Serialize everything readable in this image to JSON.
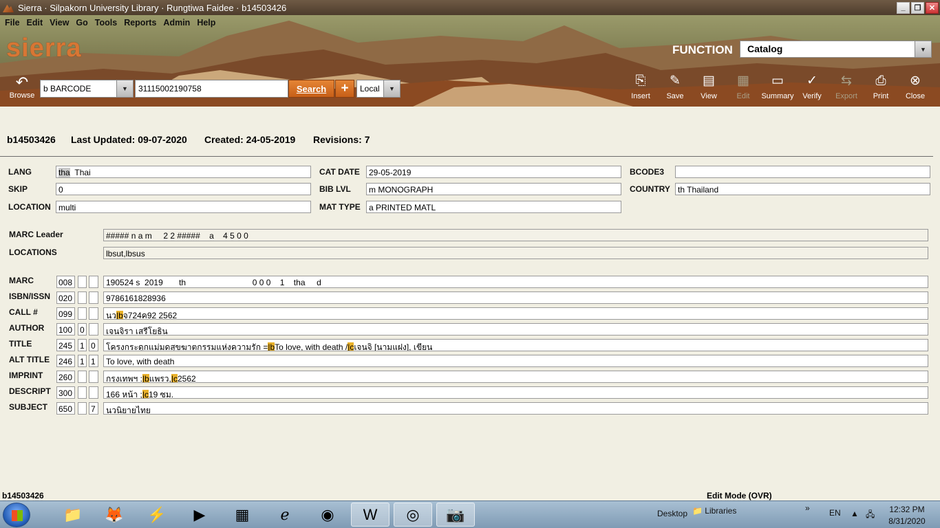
{
  "window": {
    "title": "Sierra · Silpakorn University Library · Rungtiwa Faidee · b14503426",
    "buttons": {
      "minimize": "_",
      "maximize": "❐",
      "close": "✕"
    }
  },
  "menu": [
    "File",
    "Edit",
    "View",
    "Go",
    "Tools",
    "Reports",
    "Admin",
    "Help"
  ],
  "brand": {
    "logo": "sierra",
    "accent": "#d87634"
  },
  "function": {
    "label": "FUNCTION",
    "value": "Catalog"
  },
  "search": {
    "browse_label": "Browse",
    "index": "b BARCODE",
    "query": "31115002190758",
    "search_label": "Search",
    "plus_label": "+",
    "scope": "Local"
  },
  "toolbar": [
    {
      "label": "Insert",
      "icon": "insert-icon",
      "enabled": true
    },
    {
      "label": "Save",
      "icon": "save-icon",
      "enabled": true
    },
    {
      "label": "View",
      "icon": "view-icon",
      "enabled": true
    },
    {
      "label": "Edit",
      "icon": "edit-icon",
      "enabled": false
    },
    {
      "label": "Summary",
      "icon": "summary-icon",
      "enabled": true
    },
    {
      "label": "Verify",
      "icon": "verify-icon",
      "enabled": true
    },
    {
      "label": "Export",
      "icon": "export-icon",
      "enabled": false
    },
    {
      "label": "Print",
      "icon": "print-icon",
      "enabled": true
    },
    {
      "label": "Close",
      "icon": "close-icon",
      "enabled": true
    }
  ],
  "record": {
    "id": "b14503426",
    "last_updated": "Last Updated: 09-07-2020",
    "created": "Created: 24-05-2019",
    "revisions": "Revisions: 7"
  },
  "fixed_fields": {
    "lang": {
      "label": "LANG",
      "code": "tha",
      "value": "Thai"
    },
    "skip": {
      "label": "SKIP",
      "value": "0"
    },
    "location": {
      "label": "LOCATION",
      "value": "multi"
    },
    "cat_date": {
      "label": "CAT DATE",
      "value": "29-05-2019"
    },
    "bib_lvl": {
      "label": "BIB LVL",
      "value": "m  MONOGRAPH"
    },
    "mat_type": {
      "label": "MAT TYPE",
      "value": "a  PRINTED MATL"
    },
    "bcode3": {
      "label": "BCODE3",
      "value": ""
    },
    "country": {
      "label": "COUNTRY",
      "value": "th   Thailand"
    }
  },
  "marc_leader": {
    "label": "MARC Leader",
    "value": "##### n a m     2 2 #####    a    4 5 0 0"
  },
  "locations": {
    "label": "LOCATIONS",
    "value": "lbsut,lbsus"
  },
  "marc_fields": [
    {
      "label": "MARC",
      "tag": "008",
      "ind1": "",
      "ind2": "",
      "parts": [
        [
          "t",
          "190524 s  2019       th                             0 0 0    1    tha     d"
        ]
      ]
    },
    {
      "label": "ISBN/ISSN",
      "tag": "020",
      "ind1": "",
      "ind2": "",
      "parts": [
        [
          "t",
          "9786161828936"
        ]
      ]
    },
    {
      "label": "CALL #",
      "tag": "099",
      "ind1": "",
      "ind2": "",
      "parts": [
        [
          "t",
          "นว"
        ],
        [
          "h",
          "|b"
        ],
        [
          "t",
          "จ724ค92 2562"
        ]
      ]
    },
    {
      "label": "AUTHOR",
      "tag": "100",
      "ind1": "0",
      "ind2": "",
      "parts": [
        [
          "t",
          "เจนจิรา เสรีโยธิน"
        ]
      ]
    },
    {
      "label": "TITLE",
      "tag": "245",
      "ind1": "1",
      "ind2": "0",
      "parts": [
        [
          "t",
          "โครงกระดูกแม่มดสุขฆาตกรรมแห่งความรัก ="
        ],
        [
          "h",
          "|b"
        ],
        [
          "t",
          "To love, with death /"
        ],
        [
          "h",
          "|c"
        ],
        [
          "t",
          "เจนจิ [นามแฝง], เขียน"
        ]
      ]
    },
    {
      "label": "ALT TITLE",
      "tag": "246",
      "ind1": "1",
      "ind2": "1",
      "parts": [
        [
          "t",
          "To love, with death"
        ]
      ]
    },
    {
      "label": "IMPRINT",
      "tag": "260",
      "ind1": "",
      "ind2": "",
      "parts": [
        [
          "t",
          "กรุงเทพฯ :"
        ],
        [
          "h",
          "|b"
        ],
        [
          "t",
          "แพรว,"
        ],
        [
          "h",
          "|c"
        ],
        [
          "t",
          "2562"
        ]
      ]
    },
    {
      "label": "DESCRIPT",
      "tag": "300",
      "ind1": "",
      "ind2": "",
      "parts": [
        [
          "t",
          "166 หน้า ;"
        ],
        [
          "h",
          "|c"
        ],
        [
          "t",
          "19 ซม."
        ]
      ]
    },
    {
      "label": "SUBJECT",
      "tag": "650",
      "ind1": "",
      "ind2": "7",
      "parts": [
        [
          "t",
          "นวนิยายไทย"
        ]
      ]
    }
  ],
  "statusbar": {
    "left": "b14503426",
    "right": "Edit Mode (OVR)"
  },
  "taskbar": {
    "apps": [
      "explorer-icon",
      "firefox-icon",
      "winamp-icon",
      "media-player-icon",
      "excel-icon",
      "internet-explorer-icon",
      "chrome-icon",
      "word-icon",
      "sierra-icon",
      "camera-icon"
    ],
    "desktop_label": "Desktop",
    "libraries_label": "Libraries",
    "lang": "EN",
    "time": "12:32 PM",
    "date": "8/31/2020"
  }
}
